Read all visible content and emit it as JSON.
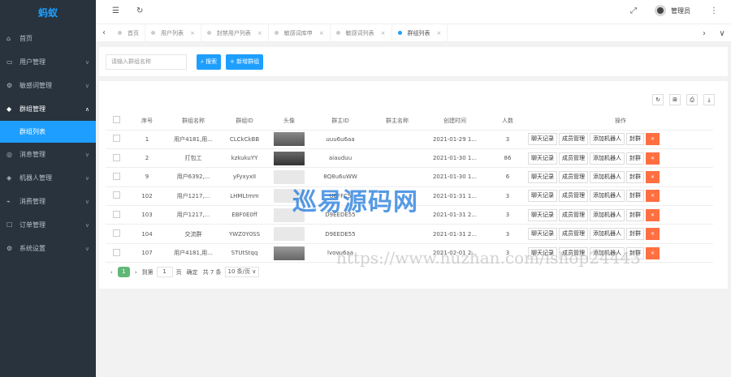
{
  "sidebar": {
    "logo": "蚂蚁",
    "items": [
      {
        "label": "首页",
        "icon": "home-icon",
        "glyph": "⌂",
        "chevron": ""
      },
      {
        "label": "用户管理",
        "icon": "folder-icon",
        "glyph": "▭",
        "chevron": "∨"
      },
      {
        "label": "敏感词管理",
        "icon": "gear-icon",
        "glyph": "⚙",
        "chevron": "∨"
      },
      {
        "label": "群组管理",
        "icon": "users-icon",
        "glyph": "◆",
        "chevron": "∧"
      },
      {
        "label": "群组列表",
        "icon": "",
        "glyph": "",
        "chevron": ""
      },
      {
        "label": "消息管理",
        "icon": "message-icon",
        "glyph": "◎",
        "chevron": "∨"
      },
      {
        "label": "机器人管理",
        "icon": "robot-icon",
        "glyph": "◈",
        "chevron": "∨"
      },
      {
        "label": "消费管理",
        "icon": "chart-icon",
        "glyph": "⌁",
        "chevron": "∨"
      },
      {
        "label": "订单管理",
        "icon": "order-icon",
        "glyph": "☐",
        "chevron": "∨"
      },
      {
        "label": "系统设置",
        "icon": "settings-icon",
        "glyph": "⚙",
        "chevron": "∨"
      }
    ]
  },
  "header": {
    "menu_icon": "☰",
    "refresh_icon": "↻",
    "fullscreen_icon": "⤢",
    "more_icon": "⋮",
    "username": "管理员"
  },
  "tabs": {
    "items": [
      {
        "label": "首页",
        "active": false
      },
      {
        "label": "用户列表",
        "active": false
      },
      {
        "label": "封禁用户列表",
        "active": false
      },
      {
        "label": "敏感词库申",
        "active": false
      },
      {
        "label": "敏感词列表",
        "active": false
      },
      {
        "label": "群组列表",
        "active": true
      }
    ],
    "close": "×",
    "left_arrow": "‹",
    "right_arrow": "›",
    "dropdown": "∨"
  },
  "search": {
    "placeholder": "请输入群组名称",
    "search_label": "搜索",
    "add_label": "+ 新增群组"
  },
  "table": {
    "tools": [
      "↻",
      "⊞",
      "⎙",
      "⤓"
    ],
    "columns": [
      "",
      "序号",
      "群组名称",
      "群组ID",
      "头像",
      "群主ID",
      "群主名称",
      "创建时间",
      "人数",
      "操作"
    ],
    "rows": [
      {
        "no": "1",
        "name": "用户4181,用...",
        "gid": "CLCkCkBB",
        "thumb": "t0",
        "owner": "uuu6u6aa",
        "owner_name": "",
        "time": "2021-01-29 1...",
        "count": "3"
      },
      {
        "no": "2",
        "name": "打包工",
        "gid": "kzkukuYY",
        "thumb": "t1",
        "owner": "aiauduu",
        "owner_name": "",
        "time": "2021-01-30 1...",
        "count": "86"
      },
      {
        "no": "9",
        "name": "用户6392,...",
        "gid": "yFyxyxII",
        "thumb": "t2",
        "owner": "8Q8u6uWW",
        "owner_name": "",
        "time": "2021-01-30 1...",
        "count": "6"
      },
      {
        "no": "102",
        "name": "用户1217,...",
        "gid": "LHMLtmm",
        "thumb": "t2",
        "owner": "UEFFC5",
        "owner_name": "",
        "time": "2021-01-31 1...",
        "count": "3"
      },
      {
        "no": "103",
        "name": "用户1217,...",
        "gid": "EBF0E0ff",
        "thumb": "t2",
        "owner": "D9EEDE55",
        "owner_name": "",
        "time": "2021-01-31 2...",
        "count": "3"
      },
      {
        "no": "104",
        "name": "交流群",
        "gid": "YWZ0Y0SS",
        "thumb": "t2",
        "owner": "D9EEDE55",
        "owner_name": "",
        "time": "2021-01-31 2...",
        "count": "3"
      },
      {
        "no": "107",
        "name": "用户4181,用...",
        "gid": "STUtStqq",
        "thumb": "t3",
        "owner": "lvovu6aa",
        "owner_name": "",
        "time": "2021-02-01 2...",
        "count": "3"
      }
    ],
    "actions": [
      "聊天记录",
      "成员管理",
      "添加机器人",
      "封群"
    ],
    "delete_icon": "🗑"
  },
  "pager": {
    "prev": "‹",
    "current": "1",
    "next": "›",
    "goto_label": "到第",
    "goto_value": "1",
    "page_unit": "页",
    "confirm": "确定",
    "total": "共 7 条",
    "per_page": "10 条/页 ∨"
  },
  "watermark": {
    "logo": "巡易源码网",
    "url": "https://www.huzhan.com/ishop24443"
  }
}
